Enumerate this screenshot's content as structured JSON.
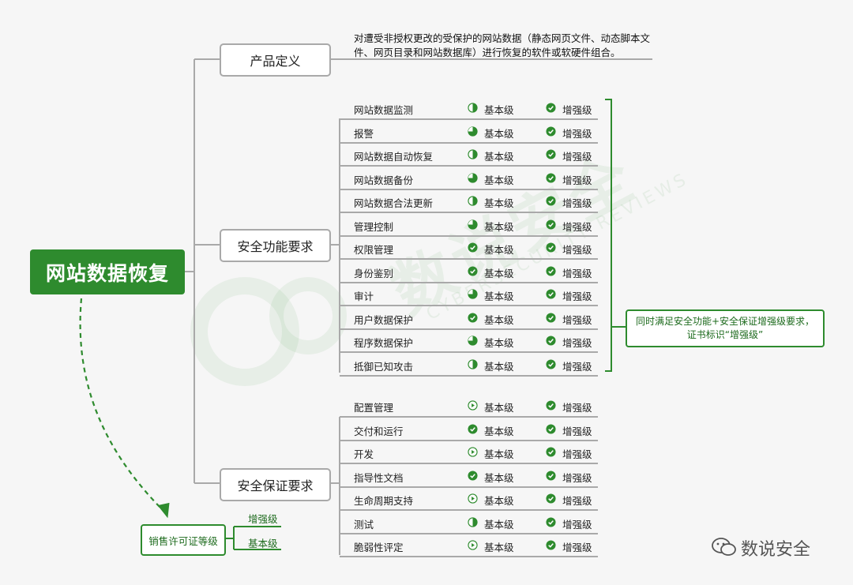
{
  "root": {
    "label": "网站数据恢复"
  },
  "definition": {
    "label": "产品定义",
    "text": "对遭受非授权更改的受保护的网站数据（静态网页文件、动态脚本文件、网页目录和网站数据库）进行恢复的软件或软硬件组合。"
  },
  "security_functions": {
    "label": "安全功能要求",
    "items": [
      {
        "name": "网站数据监测",
        "basic": "基本级",
        "enhanced": "增强级",
        "basic_icon": "half-circle-icon"
      },
      {
        "name": "报警",
        "basic": "基本级",
        "enhanced": "增强级",
        "basic_icon": "pie-icon"
      },
      {
        "name": "网站数据自动恢复",
        "basic": "基本级",
        "enhanced": "增强级",
        "basic_icon": "half-circle-icon"
      },
      {
        "name": "网站数据备份",
        "basic": "基本级",
        "enhanced": "增强级",
        "basic_icon": "pie-icon"
      },
      {
        "name": "网站数据合法更新",
        "basic": "基本级",
        "enhanced": "增强级",
        "basic_icon": "half-circle-icon"
      },
      {
        "name": "管理控制",
        "basic": "基本级",
        "enhanced": "增强级",
        "basic_icon": "pie-icon"
      },
      {
        "name": "权限管理",
        "basic": "基本级",
        "enhanced": "增强级",
        "basic_icon": "check-circle-icon"
      },
      {
        "name": "身份鉴别",
        "basic": "基本级",
        "enhanced": "增强级",
        "basic_icon": "check-circle-icon"
      },
      {
        "name": "审计",
        "basic": "基本级",
        "enhanced": "增强级",
        "basic_icon": "pie-icon"
      },
      {
        "name": "用户数据保护",
        "basic": "基本级",
        "enhanced": "增强级",
        "basic_icon": "check-circle-icon"
      },
      {
        "name": "程序数据保护",
        "basic": "基本级",
        "enhanced": "增强级",
        "basic_icon": "pie-icon"
      },
      {
        "name": "抵御已知攻击",
        "basic": "基本级",
        "enhanced": "增强级",
        "basic_icon": "half-circle-icon"
      }
    ]
  },
  "assurance": {
    "label": "安全保证要求",
    "items": [
      {
        "name": "配置管理",
        "basic": "基本级",
        "enhanced": "增强级",
        "basic_icon": "play-circle-icon"
      },
      {
        "name": "交付和运行",
        "basic": "基本级",
        "enhanced": "增强级",
        "basic_icon": "check-circle-icon"
      },
      {
        "name": "开发",
        "basic": "基本级",
        "enhanced": "增强级",
        "basic_icon": "play-circle-icon"
      },
      {
        "name": "指导性文档",
        "basic": "基本级",
        "enhanced": "增强级",
        "basic_icon": "check-circle-icon"
      },
      {
        "name": "生命周期支持",
        "basic": "基本级",
        "enhanced": "增强级",
        "basic_icon": "play-circle-icon"
      },
      {
        "name": "测试",
        "basic": "基本级",
        "enhanced": "增强级",
        "basic_icon": "half-circle-icon"
      },
      {
        "name": "脆弱性评定",
        "basic": "基本级",
        "enhanced": "增强级",
        "basic_icon": "play-circle-icon"
      }
    ]
  },
  "note": {
    "line1": "同时满足安全功能+安全保证增强级要求，",
    "line2": "证书标识“增强级”"
  },
  "sales": {
    "label": "销售许可证等级",
    "level_enhanced": "增强级",
    "level_basic": "基本级"
  },
  "watermark": {
    "text": "数说安全",
    "sub": "CYBERSECURITY REVIEWS"
  },
  "logo": {
    "text": "数说安全"
  },
  "colors": {
    "accent": "#2e8b2e",
    "line": "#a9a9a9"
  }
}
